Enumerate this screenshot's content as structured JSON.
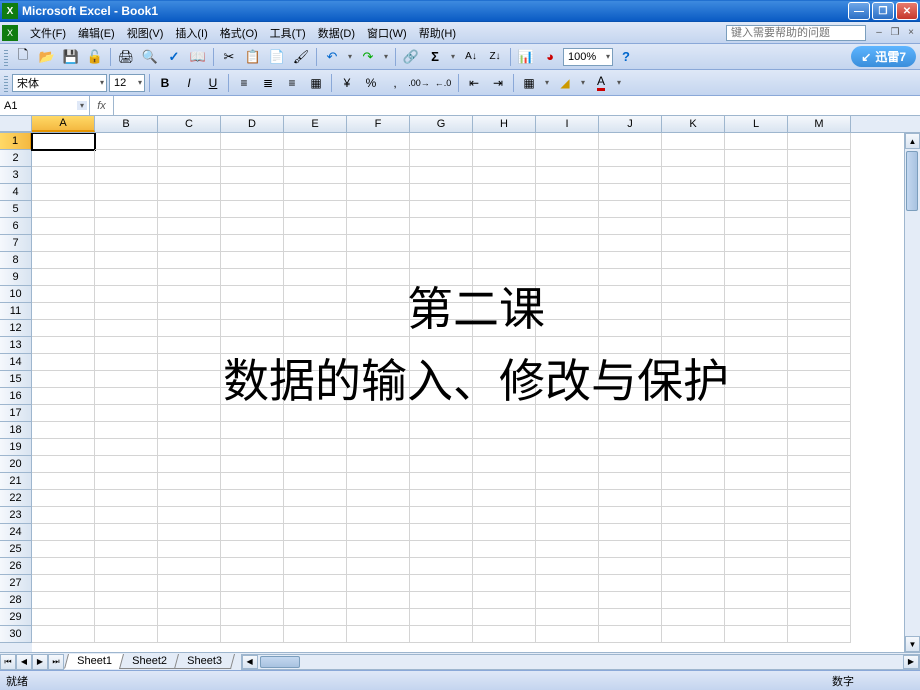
{
  "title": "Microsoft Excel - Book1",
  "menus": {
    "file": "文件(F)",
    "edit": "编辑(E)",
    "view": "视图(V)",
    "insert": "插入(I)",
    "format": "格式(O)",
    "tools": "工具(T)",
    "data": "数据(D)",
    "window": "窗口(W)",
    "help": "帮助(H)"
  },
  "help_placeholder": "键入需要帮助的问题",
  "format_toolbar": {
    "font_name": "宋体",
    "font_size": "12"
  },
  "zoom": "100%",
  "namebox": "A1",
  "columns": [
    "A",
    "B",
    "C",
    "D",
    "E",
    "F",
    "G",
    "H",
    "I",
    "J",
    "K",
    "L",
    "M"
  ],
  "row_count": 30,
  "active_cell": {
    "row": 1,
    "col": "A"
  },
  "overlay": {
    "line1": "第二课",
    "line2": "数据的输入、修改与保护"
  },
  "sheets": [
    "Sheet1",
    "Sheet2",
    "Sheet3"
  ],
  "active_sheet": 0,
  "status": {
    "left": "就绪",
    "right": "数字"
  },
  "brand": "迅雷7"
}
